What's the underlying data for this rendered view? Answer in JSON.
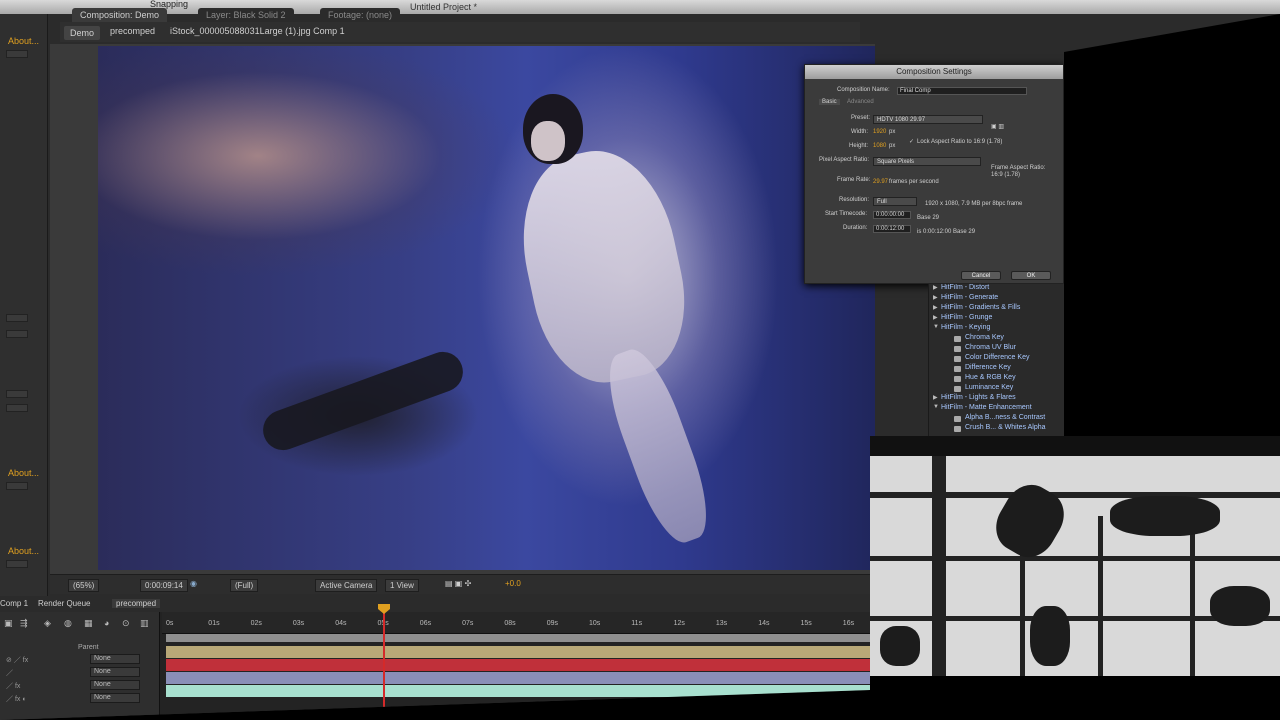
{
  "window": {
    "title": "Untitled Project *",
    "snapping": "Snapping"
  },
  "comp_panel": {
    "tab_label": "Composition: Demo",
    "layer_tab": "Layer: Black Solid 2",
    "footage_tab": "Footage: (none)",
    "breadcrumbs": [
      "Demo",
      "precomped",
      "iStock_000005088031Large (1).jpg Comp 1"
    ]
  },
  "left_panel": {
    "about_links": [
      "About...",
      "About...",
      "About..."
    ]
  },
  "viewer_bar": {
    "zoom": "(65%)",
    "timecode": "0:00:09:14",
    "resolution": "(Full)",
    "camera": "Active Camera",
    "view": "1 View",
    "exposure": "+0.0"
  },
  "dialog": {
    "title": "Composition Settings",
    "comp_name_label": "Composition Name:",
    "comp_name": "Final Comp",
    "tabs": [
      "Basic",
      "Advanced"
    ],
    "preset_label": "Preset:",
    "preset": "HDTV 1080 29.97",
    "width_label": "Width:",
    "width_value": "1920",
    "height_label": "Height:",
    "height_value": "1080",
    "px": "px",
    "lock_label": "Lock Aspect Ratio to 16:9 (1.78)",
    "par_label": "Pixel Aspect Ratio:",
    "par": "Square Pixels",
    "frame_aspect_label": "Frame Aspect Ratio:",
    "frame_aspect_value": "16:9 (1.78)",
    "frame_rate_label": "Frame Rate:",
    "frame_rate": "29.97",
    "frame_rate_unit": "frames per second",
    "resolution_label": "Resolution:",
    "resolution": "Full",
    "resolution_info": "1920 x 1080, 7.9 MB per 8bpc frame",
    "start_tc_label": "Start Timecode:",
    "start_tc": "0:00:00:00",
    "start_tc_base": "Base 29",
    "duration_label": "Duration:",
    "duration": "0:00:12:00",
    "duration_info": "is 0:00:12:00  Base 29",
    "cancel": "Cancel",
    "ok": "OK"
  },
  "effects_panel": {
    "items": [
      {
        "type": "cat",
        "label": "HitFilm - Distort",
        "open": false
      },
      {
        "type": "cat",
        "label": "HitFilm - Generate",
        "open": false
      },
      {
        "type": "cat",
        "label": "HitFilm - Gradients & Fills",
        "open": false
      },
      {
        "type": "cat",
        "label": "HitFilm - Grunge",
        "open": false
      },
      {
        "type": "cat",
        "label": "HitFilm - Keying",
        "open": true
      },
      {
        "type": "item",
        "label": "Chroma Key"
      },
      {
        "type": "item",
        "label": "Chroma UV Blur"
      },
      {
        "type": "item",
        "label": "Color Difference Key"
      },
      {
        "type": "item",
        "label": "Difference Key"
      },
      {
        "type": "item",
        "label": "Hue & RGB Key"
      },
      {
        "type": "item",
        "label": "Luminance Key"
      },
      {
        "type": "cat",
        "label": "HitFilm - Lights & Flares",
        "open": false
      },
      {
        "type": "cat",
        "label": "HitFilm - Matte Enhancement",
        "open": true
      },
      {
        "type": "item",
        "label": "Alpha B...ness & Contrast"
      },
      {
        "type": "item",
        "label": "Crush B... & Whites Alpha"
      }
    ]
  },
  "timeline": {
    "tabs": [
      "Comp 1",
      "Render Queue",
      "precomped"
    ],
    "parent_header": "Parent",
    "ticks": [
      "0s",
      "01s",
      "02s",
      "03s",
      "04s",
      "05s",
      "06s",
      "07s",
      "08s",
      "09s",
      "10s",
      "11s",
      "12s",
      "13s",
      "14s",
      "15s",
      "16s"
    ],
    "parent_values": [
      "None",
      "None",
      "None",
      "None"
    ],
    "track_colors": [
      "#b8a877",
      "#c0303a",
      "#8a8fb8",
      "#a8e0cf"
    ]
  }
}
